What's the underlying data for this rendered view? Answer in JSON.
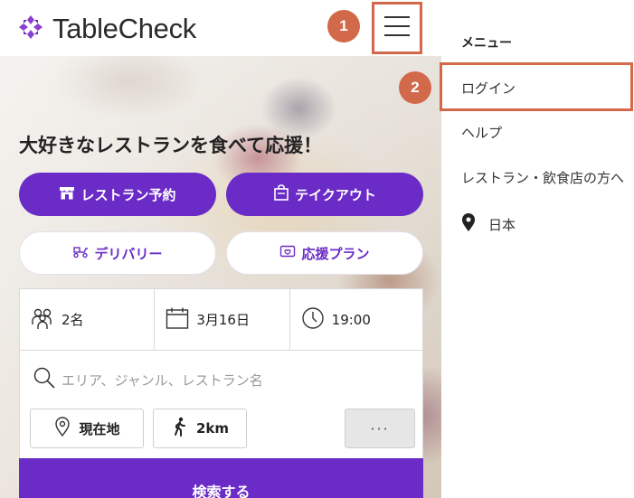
{
  "header": {
    "brand_name": "TableCheck",
    "logo_icon": "tablecheck-logo-icon",
    "menu_icon": "hamburger-menu-icon"
  },
  "annotations": {
    "step1": "1",
    "step2": "2",
    "highlight_color": "#d2694a"
  },
  "hero": {
    "headline": "大好きなレストランを食べて応援！"
  },
  "actions": {
    "reserve": {
      "label": "レストラン予約",
      "icon": "store-icon"
    },
    "takeout": {
      "label": "テイクアウト",
      "icon": "takeout-bag-icon"
    },
    "delivery": {
      "label": "デリバリー",
      "icon": "delivery-scooter-icon"
    },
    "support_plan": {
      "label": "応援プラン",
      "icon": "gift-card-icon"
    }
  },
  "search": {
    "party_size": "2名",
    "date": "3月16日",
    "time": "19:00",
    "keyword_placeholder": "エリア、ジャンル、レストラン名",
    "current_location": "現在地",
    "distance": "2km",
    "more": "···",
    "submit": "検索する"
  },
  "menu": {
    "title": "メニュー",
    "items": [
      "ログイン",
      "ヘルプ",
      "レストラン・飲食店の方へ"
    ],
    "country": "日本"
  },
  "colors": {
    "brand_purple": "#6a2bc7",
    "annotation_orange": "#d2694a"
  }
}
